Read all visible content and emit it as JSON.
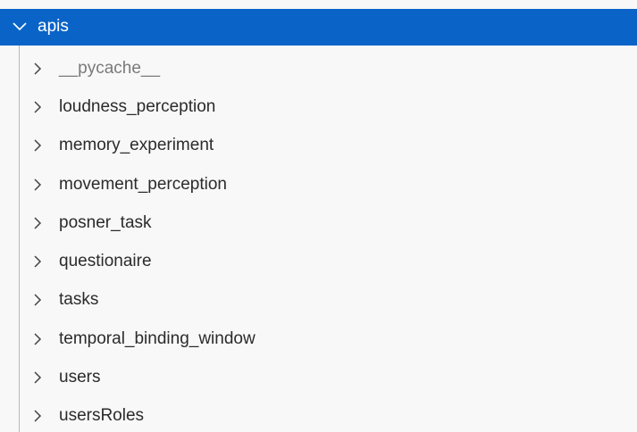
{
  "explorer": {
    "root": {
      "label": "apis",
      "icon": "chevron-down-icon",
      "expanded": true,
      "selected": true
    },
    "children": [
      {
        "label": "__pycache__",
        "icon": "chevron-right-icon",
        "dimmed": true
      },
      {
        "label": "loudness_perception",
        "icon": "chevron-right-icon",
        "dimmed": false
      },
      {
        "label": "memory_experiment",
        "icon": "chevron-right-icon",
        "dimmed": false
      },
      {
        "label": "movement_perception",
        "icon": "chevron-right-icon",
        "dimmed": false
      },
      {
        "label": "posner_task",
        "icon": "chevron-right-icon",
        "dimmed": false
      },
      {
        "label": "questionaire",
        "icon": "chevron-right-icon",
        "dimmed": false
      },
      {
        "label": "tasks",
        "icon": "chevron-right-icon",
        "dimmed": false
      },
      {
        "label": "temporal_binding_window",
        "icon": "chevron-right-icon",
        "dimmed": false
      },
      {
        "label": "users",
        "icon": "chevron-right-icon",
        "dimmed": false
      },
      {
        "label": "usersRoles",
        "icon": "chevron-right-icon",
        "dimmed": false
      }
    ],
    "colors": {
      "selection": "#0a64c8",
      "background": "#f8f8f8",
      "text": "#2b2b2b",
      "dimmed_text": "#7a7a7a",
      "guide": "#b8b8b8"
    }
  }
}
